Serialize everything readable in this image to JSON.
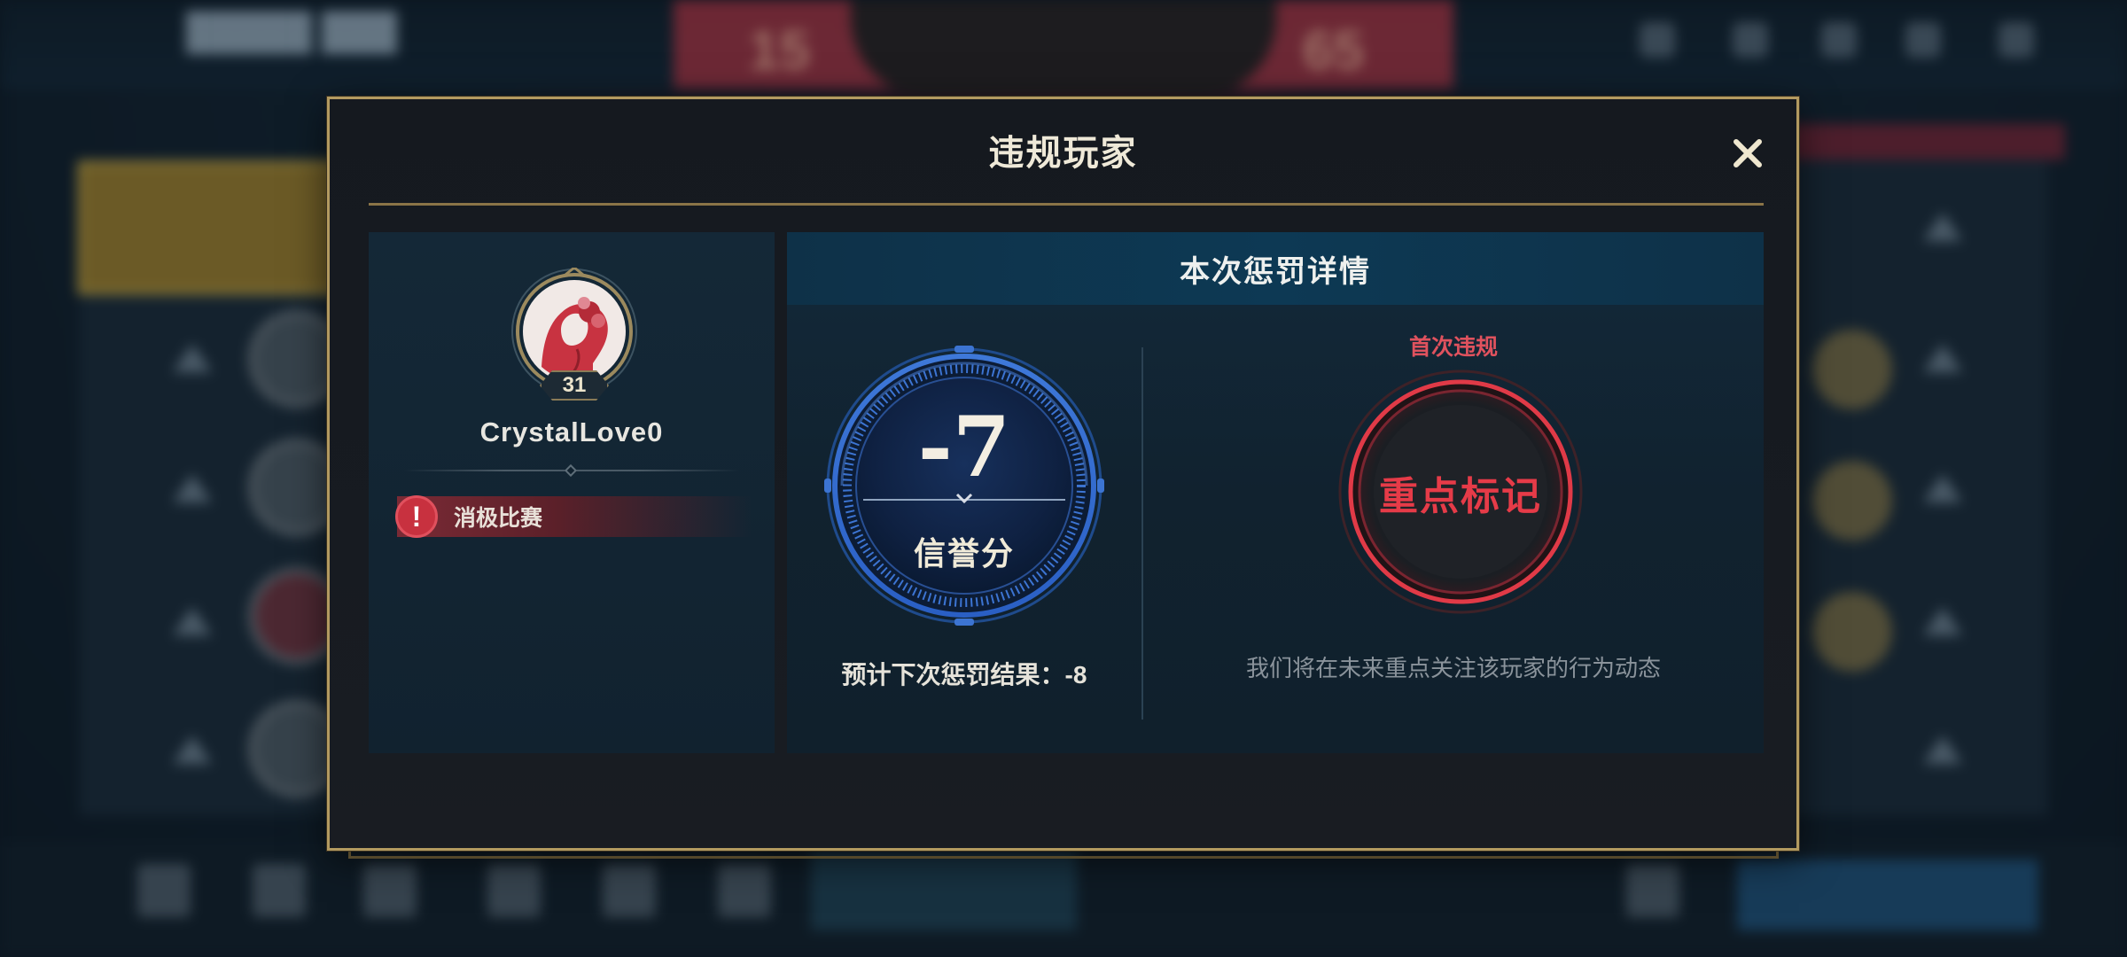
{
  "dialog": {
    "title": "违规玩家",
    "close_icon": "close-icon"
  },
  "player": {
    "level": "31",
    "name": "CrystalLove0",
    "violation_type": "消极比赛",
    "violation_icon": "exclamation-icon"
  },
  "punishment": {
    "header": "本次惩罚详情",
    "score_change": "-7",
    "score_label": "信誉分",
    "next_penalty": "预计下次惩罚结果：-8",
    "violation_count_label": "首次违规",
    "mark_label": "重点标记",
    "mark_description": "我们将在未来重点关注该玩家的行为动态"
  },
  "colors": {
    "gold_border": "#b39a60",
    "accent_red": "#e63b48",
    "dial_blue": "#2f6bd0",
    "header_teal": "#0d3954"
  }
}
